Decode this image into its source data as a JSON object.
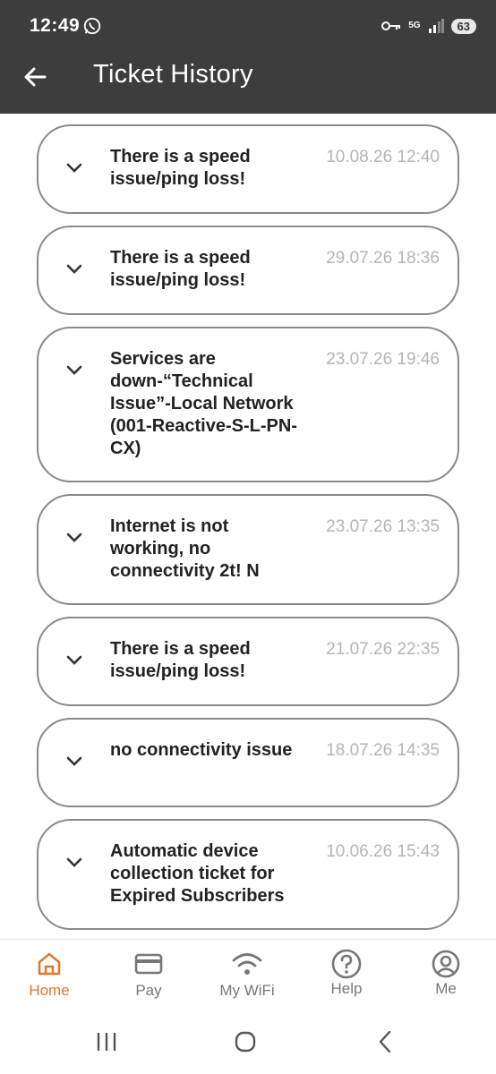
{
  "status_bar": {
    "time": "12:49",
    "network": "5G",
    "battery": "63"
  },
  "header": {
    "title": "Ticket History"
  },
  "tickets": [
    {
      "description": "There is a speed issue/ping loss!",
      "date": "10.08.26 12:40"
    },
    {
      "description": "There is a speed issue/ping loss!",
      "date": "29.07.26 18:36"
    },
    {
      "description": "Services are down-“Technical Issue”-Local Network (001-Reactive-S-L-PN-CX)",
      "date": "23.07.26 19:46"
    },
    {
      "description": "Internet is not working, no connectivity 2t! N",
      "date": "23.07.26 13:35"
    },
    {
      "description": "There is a speed issue/ping loss!",
      "date": "21.07.26 22:35"
    },
    {
      "description": "no connectivity issue",
      "date": "18.07.26 14:35"
    },
    {
      "description": "Automatic device collection ticket for Expired Subscribers",
      "date": "10.06.26 15:43"
    }
  ],
  "bottom_nav": [
    {
      "label": "Home",
      "icon": "home-icon",
      "active": true
    },
    {
      "label": "Pay",
      "icon": "card-icon",
      "active": false
    },
    {
      "label": "My WiFi",
      "icon": "wifi-icon",
      "active": false
    },
    {
      "label": "Help",
      "icon": "help-icon",
      "active": false
    },
    {
      "label": "Me",
      "icon": "profile-icon",
      "active": false
    }
  ],
  "colors": {
    "header_bg": "#3d3d3d",
    "accent": "#e07b2d",
    "card_border": "#8a8a8a",
    "date_text": "#b5b5b5"
  }
}
